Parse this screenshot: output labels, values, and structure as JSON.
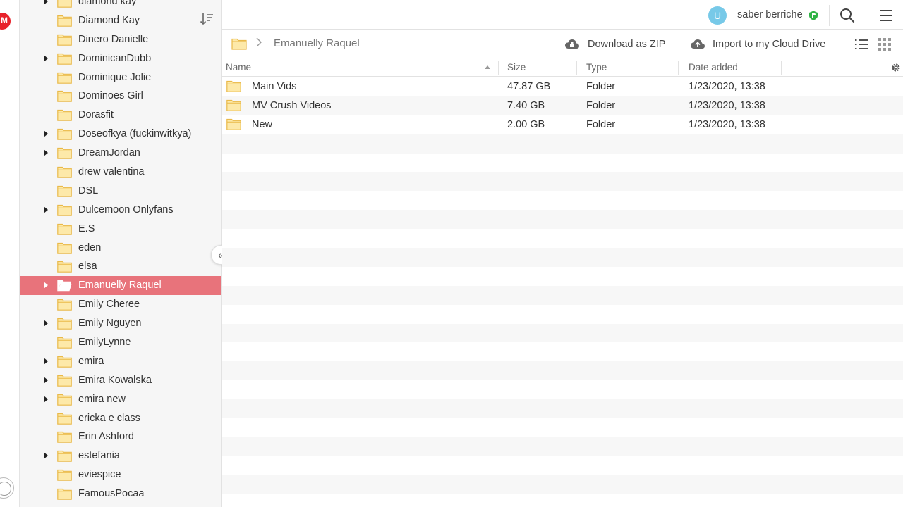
{
  "colors": {
    "selected_bg": "#e8737b",
    "folder_fill": "#fde9a9",
    "folder_stroke": "#e9b949",
    "avatar_bg": "#77c9e8",
    "brand_red": "#e8222b",
    "pro_badge": "#2fb344"
  },
  "header": {
    "avatar_initial": "U",
    "username": "saber berriche"
  },
  "breadcrumb": {
    "current": "Emanuelly Raquel"
  },
  "actions": {
    "download_zip": "Download as ZIP",
    "import_cloud": "Import to my Cloud Drive"
  },
  "table": {
    "columns": {
      "name": "Name",
      "size": "Size",
      "type": "Type",
      "date": "Date added"
    },
    "rows": [
      {
        "name": "Main Vids",
        "size": "47.87 GB",
        "type": "Folder",
        "date": "1/23/2020, 13:38"
      },
      {
        "name": "MV Crush Videos",
        "size": "7.40 GB",
        "type": "Folder",
        "date": "1/23/2020, 13:38"
      },
      {
        "name": "New",
        "size": "2.00 GB",
        "type": "Folder",
        "date": "1/23/2020, 13:38"
      }
    ]
  },
  "tree": {
    "items": [
      {
        "label": "diamond kay",
        "has_children": true,
        "selected": false
      },
      {
        "label": "Diamond Kay",
        "has_children": false,
        "selected": false
      },
      {
        "label": "Dinero Danielle",
        "has_children": false,
        "selected": false
      },
      {
        "label": "DominicanDubb",
        "has_children": true,
        "selected": false
      },
      {
        "label": "Dominique Jolie",
        "has_children": false,
        "selected": false
      },
      {
        "label": "Dominoes Girl",
        "has_children": false,
        "selected": false
      },
      {
        "label": "Dorasfit",
        "has_children": false,
        "selected": false
      },
      {
        "label": "Doseofkya (fuckinwitkya)",
        "has_children": true,
        "selected": false
      },
      {
        "label": "DreamJordan",
        "has_children": true,
        "selected": false
      },
      {
        "label": "drew valentina",
        "has_children": false,
        "selected": false
      },
      {
        "label": "DSL",
        "has_children": false,
        "selected": false
      },
      {
        "label": "Dulcemoon Onlyfans",
        "has_children": true,
        "selected": false
      },
      {
        "label": "E.S",
        "has_children": false,
        "selected": false
      },
      {
        "label": "eden",
        "has_children": false,
        "selected": false
      },
      {
        "label": "elsa",
        "has_children": false,
        "selected": false
      },
      {
        "label": "Emanuelly Raquel",
        "has_children": true,
        "selected": true
      },
      {
        "label": "Emily Cheree",
        "has_children": false,
        "selected": false
      },
      {
        "label": "Emily Nguyen",
        "has_children": true,
        "selected": false
      },
      {
        "label": "EmilyLynne",
        "has_children": false,
        "selected": false
      },
      {
        "label": "emira",
        "has_children": true,
        "selected": false
      },
      {
        "label": "Emira Kowalska",
        "has_children": true,
        "selected": false
      },
      {
        "label": "emira new",
        "has_children": true,
        "selected": false
      },
      {
        "label": "ericka e class",
        "has_children": false,
        "selected": false
      },
      {
        "label": "Erin Ashford",
        "has_children": false,
        "selected": false
      },
      {
        "label": "estefania",
        "has_children": true,
        "selected": false
      },
      {
        "label": "eviespice",
        "has_children": false,
        "selected": false
      },
      {
        "label": "FamousPocaa",
        "has_children": false,
        "selected": false
      }
    ]
  }
}
